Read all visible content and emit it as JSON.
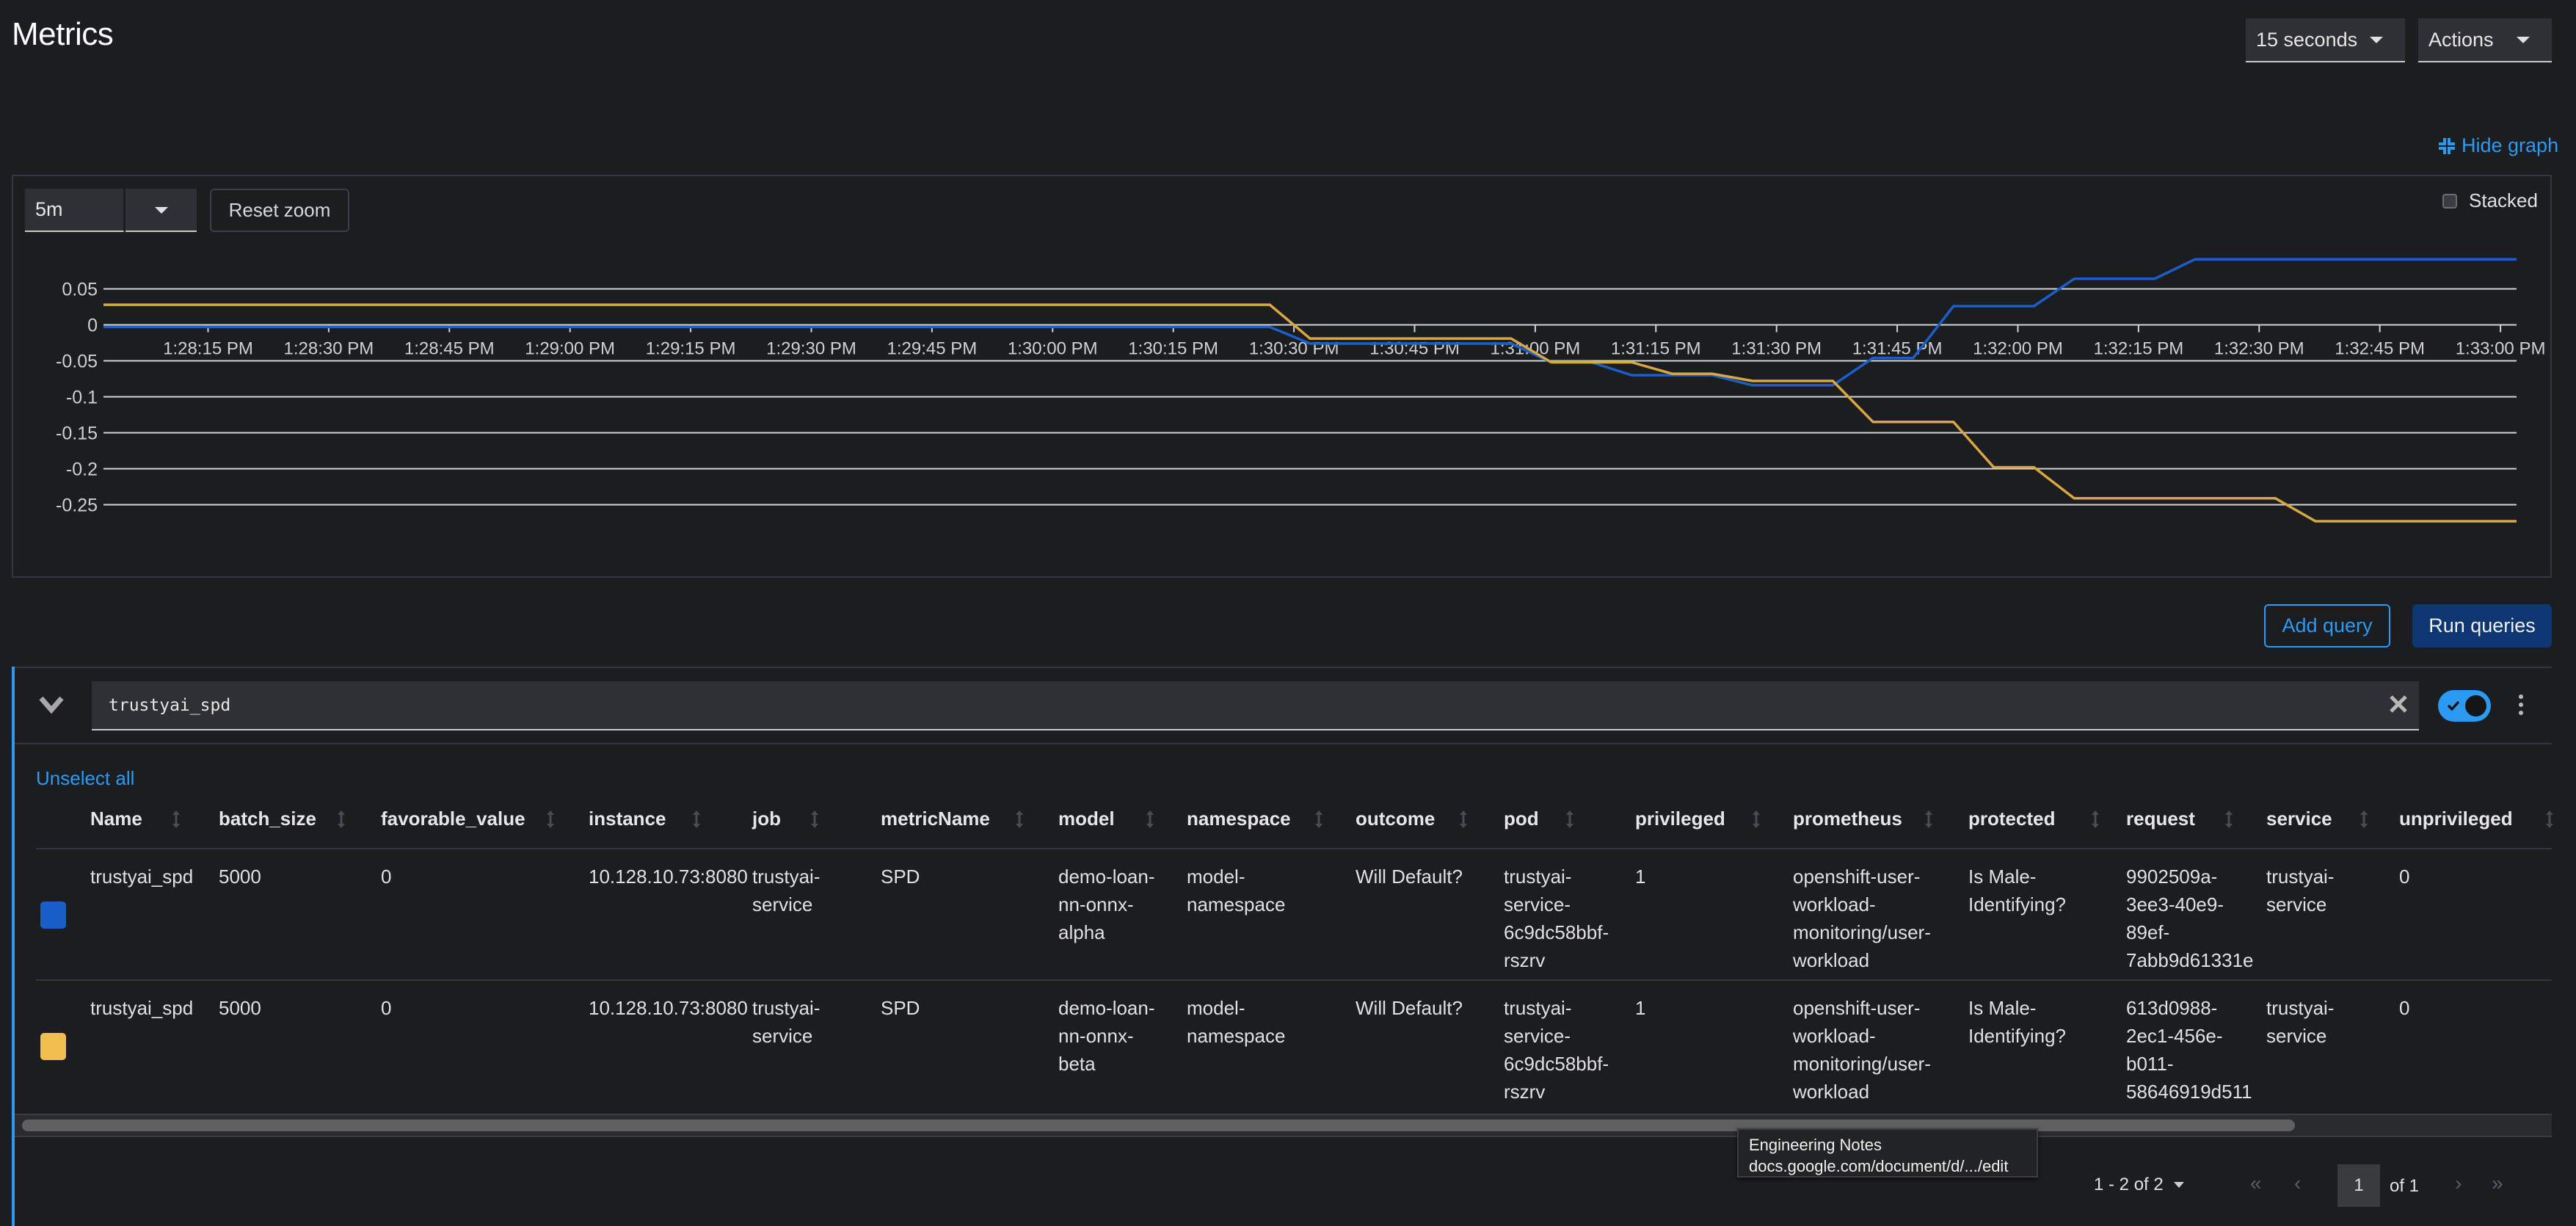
{
  "page": {
    "title": "Metrics",
    "refresh_interval": "15 seconds",
    "actions_label": "Actions",
    "hide_graph_label": "Hide graph",
    "hide_graph_icon": "compress-icon"
  },
  "graph_controls": {
    "time_range": "5m",
    "reset_zoom_label": "Reset zoom",
    "stacked_label": "Stacked",
    "stacked_checked": false
  },
  "query_actions": {
    "add_query_label": "Add query",
    "run_queries_label": "Run queries"
  },
  "query": {
    "expression": "trustyai_spd",
    "enabled": true,
    "clear_icon": "close-icon",
    "expand_icon": "chevron-down-icon",
    "menu_icon": "kebab-icon"
  },
  "table": {
    "unselect_all_label": "Unselect all",
    "columns": [
      "Name",
      "batch_size",
      "favorable_value",
      "instance",
      "job",
      "metricName",
      "model",
      "namespace",
      "outcome",
      "pod",
      "privileged",
      "prometheus",
      "protected",
      "request",
      "service",
      "unprivileged"
    ],
    "rows": [
      {
        "color": "#1c5ec7",
        "cells": [
          "trustyai_spd",
          "5000",
          "0",
          "10.128.10.73:8080",
          "trustyai-service",
          "SPD",
          "demo-loan-nn-onnx-alpha",
          "model-namespace",
          "Will Default?",
          "trustyai-service-6c9dc58bbf-rszrv",
          "1",
          "openshift-user-workload-monitoring/user-workload",
          "Is Male-Identifying?",
          "9902509a-3ee3-40e9-89ef-7abb9d61331e",
          "trustyai-service",
          "0"
        ],
        "wrapped": [
          "trustyai_spd",
          "5000",
          "0",
          "10.128.10.73:8080",
          "trustyai-\nservice",
          "SPD",
          "demo-loan-\nnn-onnx-\nalpha",
          "model-\nnamespace",
          "Will Default?",
          "trustyai-\nservice-\n6c9dc58bbf-\nrszrv",
          "1",
          "openshift-user-\nworkload-\nmonitoring/user-\nworkload",
          "Is Male-\nIdentifying?",
          "9902509a-\n3ee3-40e9-\n89ef-\n7abb9d61331e",
          "trustyai-\nservice",
          "0"
        ]
      },
      {
        "color": "#f0bd4f",
        "cells": [
          "trustyai_spd",
          "5000",
          "0",
          "10.128.10.73:8080",
          "trustyai-service",
          "SPD",
          "demo-loan-nn-onnx-beta",
          "model-namespace",
          "Will Default?",
          "trustyai-service-6c9dc58bbf-rszrv",
          "1",
          "openshift-user-workload-monitoring/user-workload",
          "Is Male-Identifying?",
          "613d0988-2ec1-456e-b011-58646919d511",
          "trustyai-service",
          "0"
        ],
        "wrapped": [
          "trustyai_spd",
          "5000",
          "0",
          "10.128.10.73:8080",
          "trustyai-\nservice",
          "SPD",
          "demo-loan-\nnn-onnx-\nbeta",
          "model-\nnamespace",
          "Will Default?",
          "trustyai-\nservice-\n6c9dc58bbf-\nrszrv",
          "1",
          "openshift-user-\nworkload-\nmonitoring/user-\nworkload",
          "Is Male-\nIdentifying?",
          "613d0988-\n2ec1-456e-\nb011-\n58646919d511",
          "trustyai-\nservice",
          "0"
        ]
      }
    ]
  },
  "tooltip": {
    "title": "Engineering Notes",
    "url": "docs.google.com/document/d/.../edit"
  },
  "pagination": {
    "range_label": "1 - 2 of 2",
    "current_page": "1",
    "total_label": "of 1"
  },
  "colors": {
    "accent": "#2b9af3",
    "series_alpha": "#1c5ec7",
    "series_beta": "#d9a73f",
    "primary_button": "#0d3672"
  },
  "chart_data": {
    "type": "line",
    "title": "",
    "xlabel": "",
    "ylabel": "",
    "ylim": [
      -0.3,
      0.06
    ],
    "yticks": [
      0.05,
      0,
      -0.05,
      -0.1,
      -0.15,
      -0.2,
      -0.25
    ],
    "ytick_labels": [
      "0.05",
      "0",
      "-0.05",
      "-0.1",
      "-0.15",
      "-0.2",
      "-0.25"
    ],
    "x_start": "1:28:02 PM",
    "x_step_seconds": 5,
    "x_range_seconds": [
      0,
      300
    ],
    "xtick_seconds": [
      13,
      28,
      43,
      58,
      73,
      88,
      103,
      118,
      133,
      148,
      163,
      178,
      193,
      208,
      223,
      238,
      253,
      268,
      283,
      298
    ],
    "xtick_labels": [
      "1:28:15 PM",
      "1:28:30 PM",
      "1:28:45 PM",
      "1:29:00 PM",
      "1:29:15 PM",
      "1:29:30 PM",
      "1:29:45 PM",
      "1:30:00 PM",
      "1:30:15 PM",
      "1:30:30 PM",
      "1:30:45 PM",
      "1:31:00 PM",
      "1:31:15 PM",
      "1:31:30 PM",
      "1:31:45 PM",
      "1:32:00 PM",
      "1:32:15 PM",
      "1:32:30 PM",
      "1:32:45 PM",
      "1:33:00 PM"
    ],
    "grid": true,
    "legend": "table-below",
    "series": [
      {
        "name": "trustyai_spd demo-loan-nn-onnx-alpha",
        "color": "#1c5ec7",
        "values": [
          -0.003,
          -0.003,
          -0.003,
          -0.003,
          -0.003,
          -0.003,
          -0.003,
          -0.003,
          -0.003,
          -0.003,
          -0.003,
          -0.003,
          -0.003,
          -0.003,
          -0.003,
          -0.003,
          -0.003,
          -0.003,
          -0.003,
          -0.003,
          -0.003,
          -0.003,
          -0.003,
          -0.003,
          -0.003,
          -0.003,
          -0.003,
          -0.003,
          -0.003,
          -0.003,
          -0.026,
          -0.026,
          -0.026,
          -0.026,
          -0.026,
          -0.026,
          -0.052,
          -0.052,
          -0.07,
          -0.07,
          -0.07,
          -0.084,
          -0.084,
          -0.084,
          -0.046,
          -0.046,
          0.026,
          0.026,
          0.026,
          0.064,
          0.064,
          0.064,
          0.091,
          0.091,
          0.091,
          0.091,
          0.091,
          0.091,
          0.091,
          0.091,
          0.091
        ]
      },
      {
        "name": "trustyai_spd demo-loan-nn-onnx-beta",
        "color": "#d9a73f",
        "values": [
          0.028,
          0.028,
          0.028,
          0.028,
          0.028,
          0.028,
          0.028,
          0.028,
          0.028,
          0.028,
          0.028,
          0.028,
          0.028,
          0.028,
          0.028,
          0.028,
          0.028,
          0.028,
          0.028,
          0.028,
          0.028,
          0.028,
          0.028,
          0.028,
          0.028,
          0.028,
          0.028,
          0.028,
          0.028,
          0.028,
          -0.019,
          -0.019,
          -0.019,
          -0.019,
          -0.019,
          -0.019,
          -0.052,
          -0.052,
          -0.052,
          -0.068,
          -0.068,
          -0.078,
          -0.078,
          -0.078,
          -0.135,
          -0.135,
          -0.135,
          -0.198,
          -0.198,
          -0.241,
          -0.241,
          -0.241,
          -0.241,
          -0.241,
          -0.241,
          -0.273,
          -0.273,
          -0.273,
          -0.273,
          -0.273,
          -0.273
        ]
      }
    ]
  }
}
